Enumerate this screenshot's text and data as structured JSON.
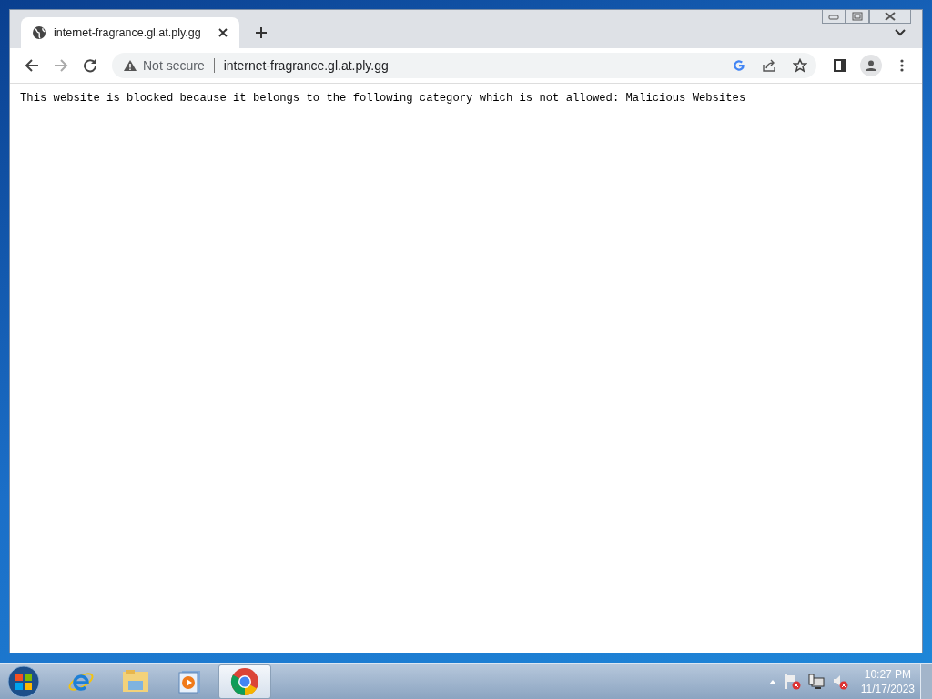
{
  "tabs": [
    {
      "title": "internet-fragrance.gl.at.ply.gg",
      "selected": true
    }
  ],
  "omnibox": {
    "security": "Not secure",
    "url": "internet-fragrance.gl.at.ply.gg"
  },
  "page": {
    "message": "This website is blocked because it belongs to the following category which is not allowed: Malicious Websites"
  },
  "taskbar": {
    "apps": [
      {
        "kind": "browser-e",
        "selected": false
      },
      {
        "kind": "folder",
        "selected": false
      },
      {
        "kind": "media",
        "selected": false
      },
      {
        "kind": "chrome",
        "selected": true
      }
    ]
  },
  "clock": {
    "time": "10:27 PM",
    "date": "11/17/2023"
  }
}
